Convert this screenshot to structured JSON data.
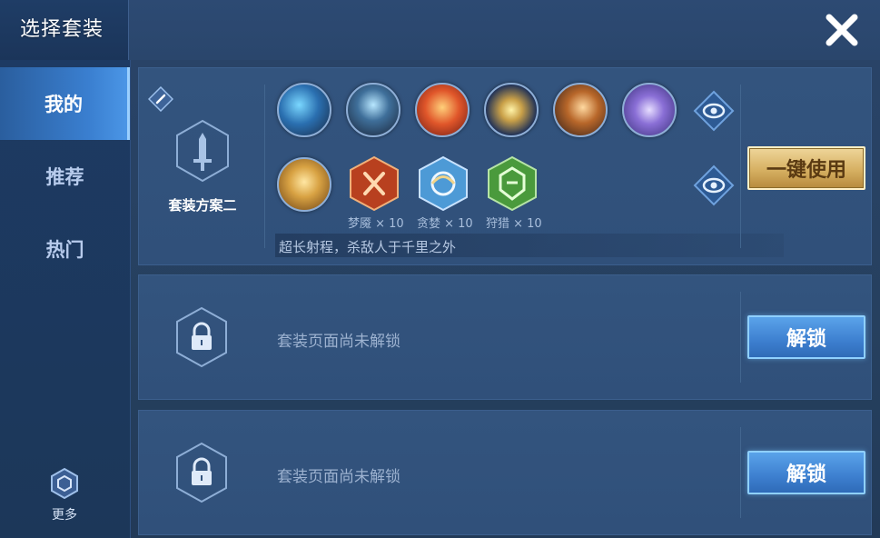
{
  "header": {
    "title": "选择套装",
    "close_icon": "close-icon"
  },
  "sidebar": {
    "items": [
      {
        "label": "我的",
        "active": true
      },
      {
        "label": "推荐",
        "active": false
      },
      {
        "label": "热门",
        "active": false
      }
    ],
    "more_label": "更多"
  },
  "suits": [
    {
      "name": "套装方案二",
      "icon": "sword-icon",
      "edit_icon": "edit-icon",
      "items": [
        "equipment-1",
        "equipment-2",
        "equipment-3",
        "equipment-4",
        "equipment-5",
        "equipment-6"
      ],
      "spells": [
        "spell-1"
      ],
      "runes": [
        {
          "label": "梦魇 × 10",
          "color": "#b8401f"
        },
        {
          "label": "贪婪 × 10",
          "color": "#4d9ad6"
        },
        {
          "label": "狩猎 × 10",
          "color": "#4a9a3c"
        }
      ],
      "description": "超长射程，杀敌人于千里之外",
      "button_label": "一键使用",
      "preview_icon": "eye-icon"
    },
    {
      "locked_text": "套装页面尚未解锁",
      "button_label": "解锁",
      "icon": "lock-icon"
    },
    {
      "locked_text": "套装页面尚未解锁",
      "button_label": "解锁",
      "icon": "lock-icon"
    }
  ],
  "colors": {
    "accent_gold": "#d6b062",
    "accent_blue": "#3d7fcf",
    "background": "#2a4469"
  }
}
